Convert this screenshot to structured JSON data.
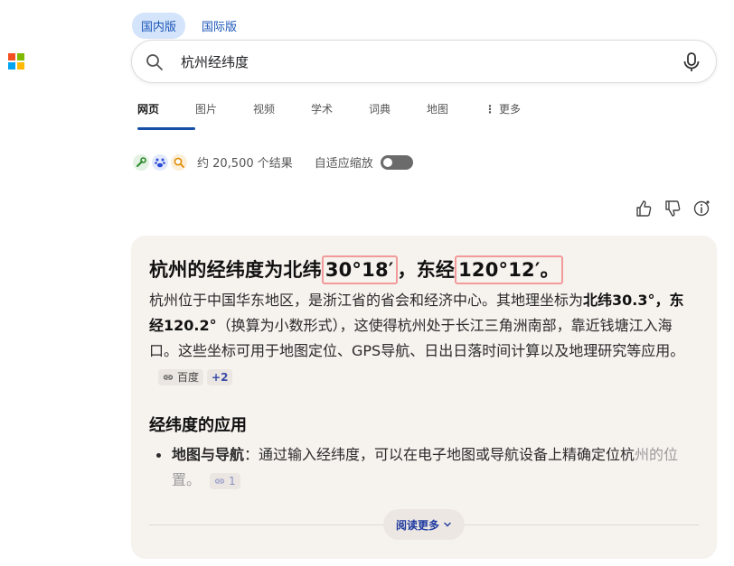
{
  "market": {
    "domestic": "国内版",
    "international": "国际版"
  },
  "search": {
    "query": "杭州经纬度"
  },
  "tabs": [
    {
      "label": "网页",
      "w": 64
    },
    {
      "label": "图片",
      "w": 64
    },
    {
      "label": "视频",
      "w": 64
    },
    {
      "label": "学术",
      "w": 64
    },
    {
      "label": "词典",
      "w": 64
    },
    {
      "label": "地图",
      "w": 64
    },
    {
      "label": "更多",
      "w": 64
    }
  ],
  "results": {
    "count_text": "约 20,500 个结果",
    "zoom_label": "自适应缩放"
  },
  "answer": {
    "title_prefix": "杭州的经纬度为北纬",
    "lat": "30°18′",
    "mid": "，东经",
    "lon": "120°12′",
    "suffix": "。",
    "p1_a": "杭州位于中国华东地区，是浙江省的省会和经济中心。其地理坐标为",
    "p1_b1": "北纬30.3°",
    "p1_c": "，",
    "p1_b2": "东经120.2°",
    "p1_d": "（换算为小数形式），这使得杭州处于长江三角洲南部，靠近钱塘江入海口。这些坐标可用于地图定位、GPS导航、日出日落时间计算以及地理研究等应用。",
    "cite1": "百度",
    "cite_more": "+2",
    "section_title": "经纬度的应用",
    "bullet_title": "地图与导航",
    "bullet_text": "：通过输入经纬度，可以在电子地图或导航设备上精确定位杭",
    "bullet_faded": "州的位置。",
    "bullet_cite": "1",
    "read_more": "阅读更多"
  },
  "colors": {
    "accent": "#174ea6",
    "card_bg": "#f6f2ee",
    "highlight_border": "#f29a9a"
  }
}
